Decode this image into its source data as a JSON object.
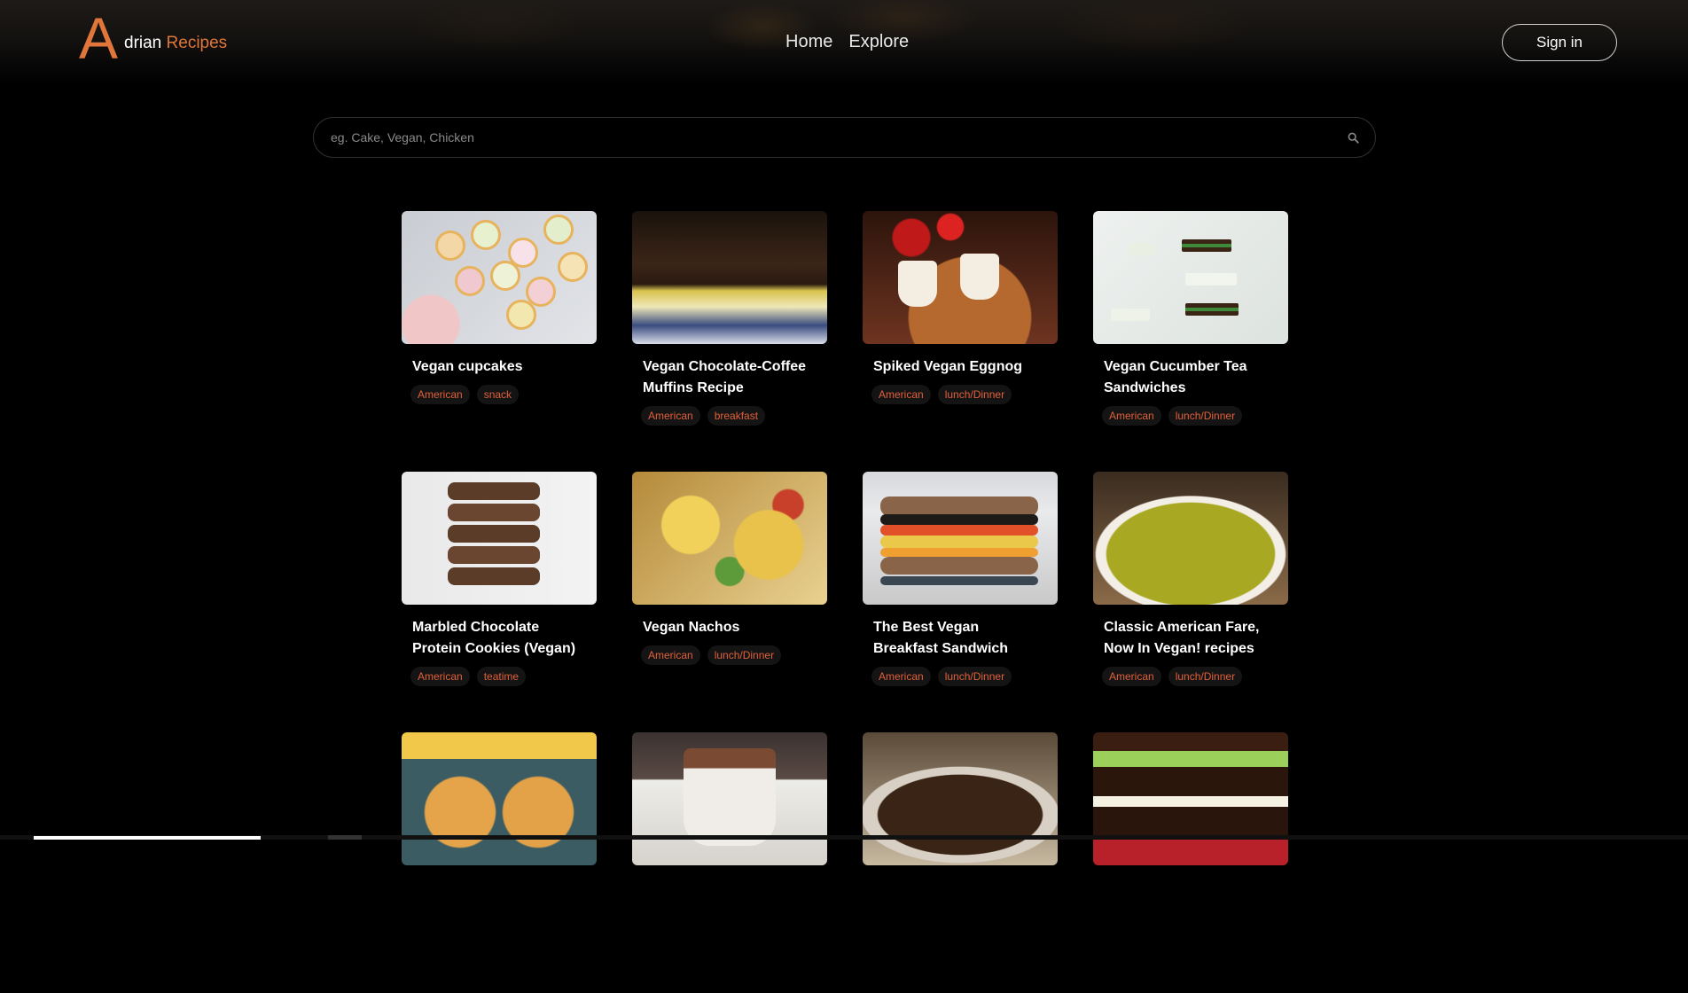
{
  "header": {
    "logo_mark": "A",
    "logo_first": "drian",
    "logo_second": "Recipes",
    "nav": [
      {
        "label": "Home"
      },
      {
        "label": "Explore"
      }
    ],
    "signin_label": "Sign in"
  },
  "search": {
    "placeholder": "eg. Cake, Vegan, Chicken",
    "value": ""
  },
  "colors": {
    "accent": "#e0763a",
    "tag_text": "#e2603a",
    "background": "#000000"
  },
  "recipes": [
    {
      "title": "Vegan cupcakes",
      "tags": [
        "American",
        "snack"
      ]
    },
    {
      "title": "Vegan Chocolate-Coffee Muffins Recipe",
      "tags": [
        "American",
        "breakfast"
      ]
    },
    {
      "title": "Spiked Vegan Eggnog",
      "tags": [
        "American",
        "lunch/Dinner"
      ]
    },
    {
      "title": "Vegan Cucumber Tea Sandwiches",
      "tags": [
        "American",
        "lunch/Dinner"
      ]
    },
    {
      "title": "Marbled Chocolate Protein Cookies (Vegan)",
      "tags": [
        "American",
        "teatime"
      ]
    },
    {
      "title": "Vegan Nachos",
      "tags": [
        "American",
        "lunch/Dinner"
      ]
    },
    {
      "title": "The Best Vegan Breakfast Sandwich",
      "tags": [
        "American",
        "lunch/Dinner"
      ]
    },
    {
      "title": "Classic American Fare, Now In Vegan! recipes",
      "tags": [
        "American",
        "lunch/Dinner"
      ]
    }
  ]
}
